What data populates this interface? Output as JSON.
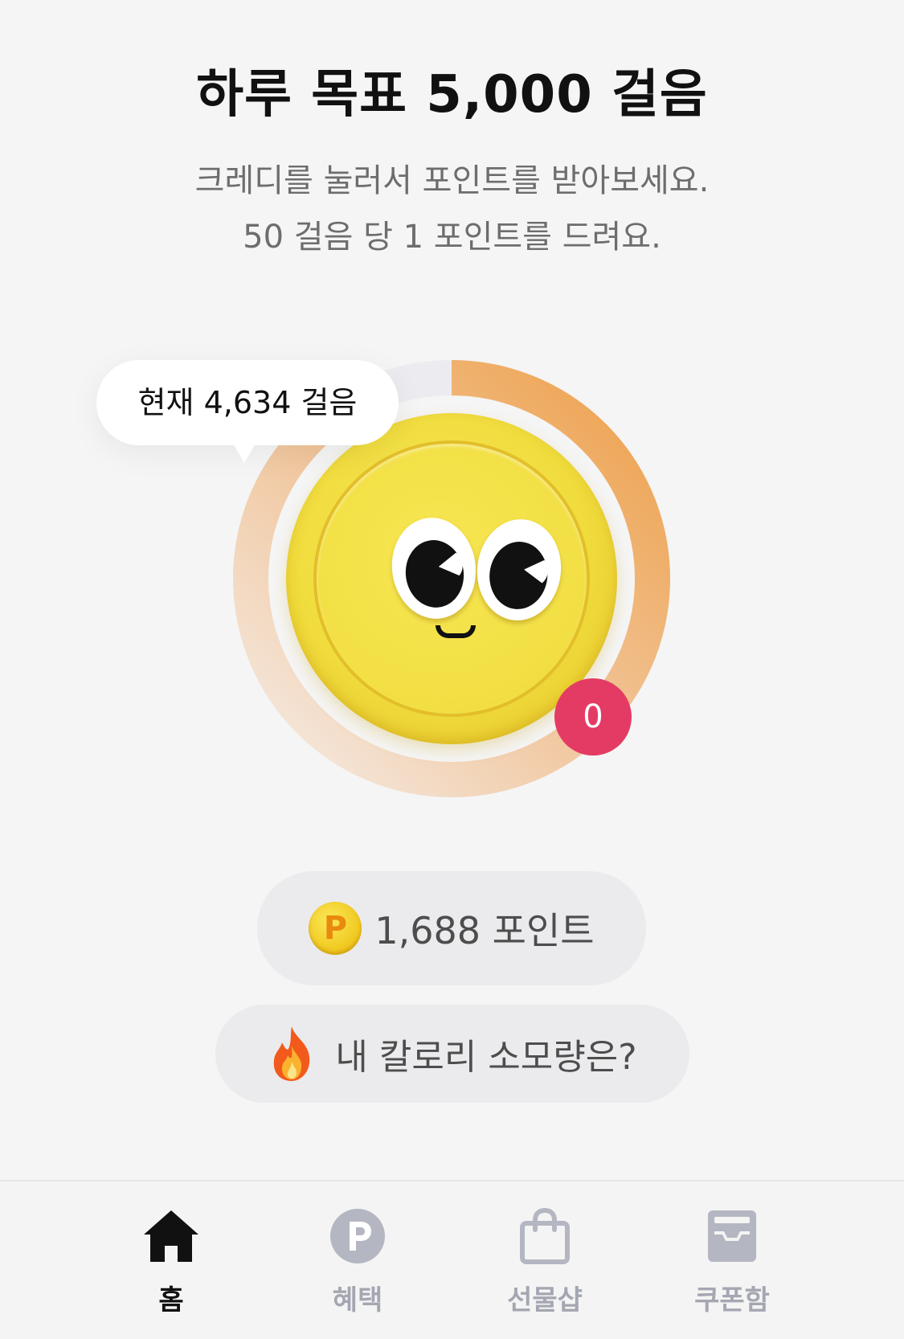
{
  "header": {
    "title": "하루 목표 5,000 걸음",
    "subtitle_line1": "크레디를 눌러서 포인트를 받아보세요.",
    "subtitle_line2": "50 걸음 당 1 포인트를 드려요."
  },
  "steps": {
    "current_label": "현재 4,634 걸음",
    "current": 4634,
    "goal": 5000
  },
  "character": {
    "name": "credi-coin",
    "badge_count": "0"
  },
  "points": {
    "icon_letter": "P",
    "label": "1,688 포인트"
  },
  "calorie": {
    "label": "내 칼로리 소모량은?"
  },
  "nav": {
    "items": [
      {
        "label": "홈",
        "icon": "home-icon",
        "active": true
      },
      {
        "label": "혜택",
        "icon": "points-icon",
        "active": false
      },
      {
        "label": "선물샵",
        "icon": "shopping-bag-icon",
        "active": false
      },
      {
        "label": "쿠폰함",
        "icon": "coupon-box-icon",
        "active": false
      }
    ]
  },
  "colors": {
    "accent_orange": "#f0a040",
    "badge_pink": "#e43b64",
    "coin_yellow": "#f0dc3c",
    "inactive_gray": "#a4a7b2"
  }
}
